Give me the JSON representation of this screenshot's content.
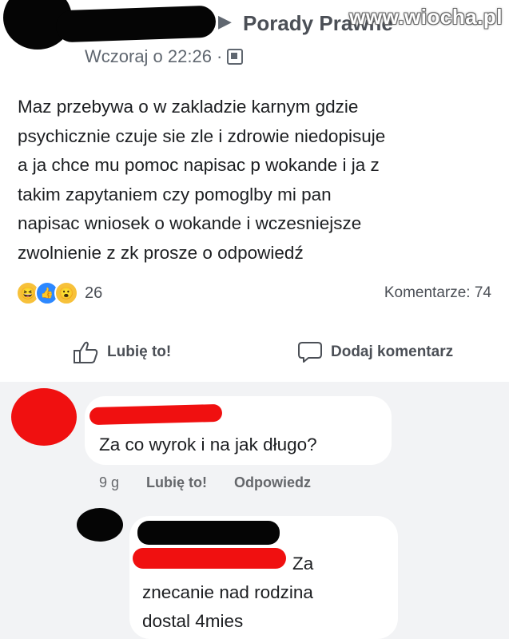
{
  "post": {
    "group_name": "Porady Prawne",
    "watermark": "www.wiocha.pl",
    "timestamp": "Wczoraj o 22:26",
    "separator": "·",
    "body_lines": [
      "Maz przebywa o w zakladzie karnym gdzie",
      "psychicznie czuje sie zle i zdrowie niedopisuje",
      "a ja chce mu pomoc napisac p wokande i ja z",
      "takim zapytaniem czy pomoglby mi pan",
      "napisac wniosek o wokande i wczesniejsze",
      "zwolnienie z zk prosze o odpowiedź"
    ],
    "reaction_count": "26",
    "comments_label": "Komentarze: 74"
  },
  "actions": {
    "like_label": "Lubię to!",
    "comment_label": "Dodaj komentarz"
  },
  "comment": {
    "text": "Za co wyrok i na jak długo?",
    "age": "9 g",
    "like_label": "Lubię to!",
    "reply_label": "Odpowiedz"
  },
  "reply": {
    "lines": [
      "Za",
      "znecanie nad rodzina",
      "dostal 4mies"
    ]
  },
  "icons": {
    "arrow": "caret-right-icon",
    "audience": "group-audience-icon",
    "haha": "haha-reaction-icon",
    "like_reaction": "like-reaction-icon",
    "wow": "wow-reaction-icon",
    "like_button": "thumbs-up-icon",
    "comment_button": "speech-bubble-icon"
  },
  "colors": {
    "redaction_red": "#f01010",
    "redaction_black": "#050505",
    "like_blue": "#2d88ff"
  }
}
